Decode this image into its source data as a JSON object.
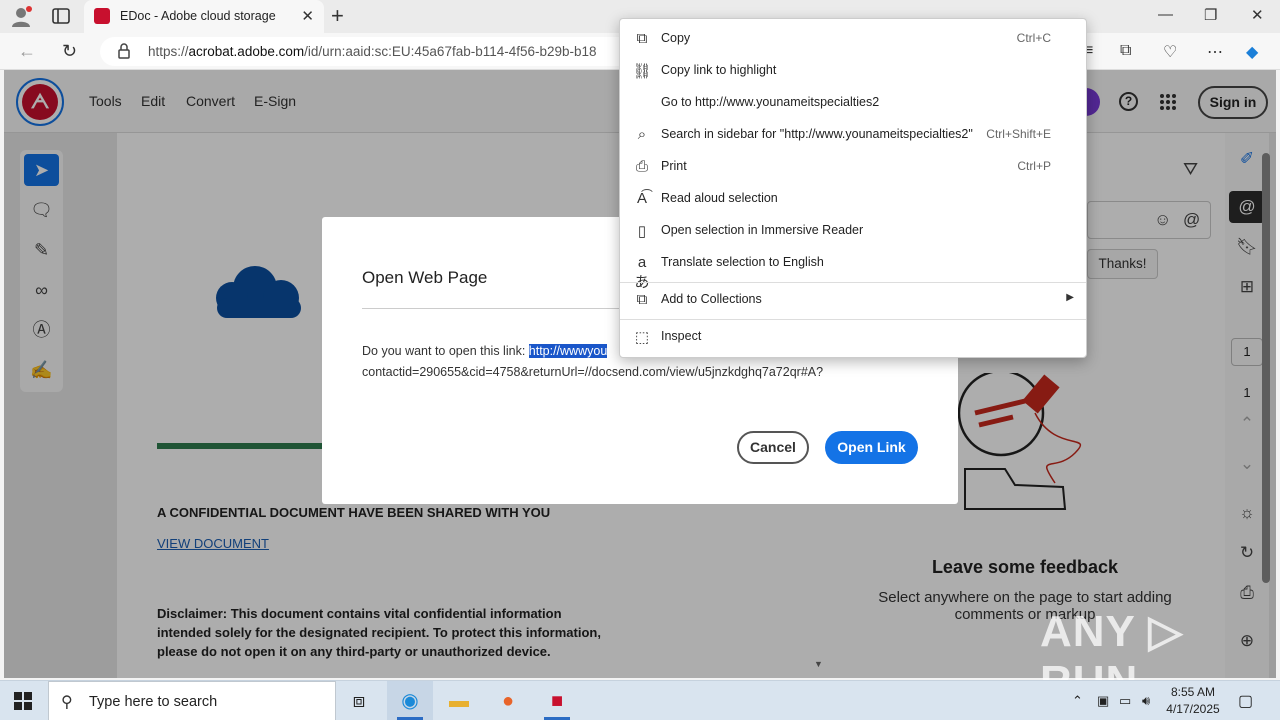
{
  "browser": {
    "tab_title": "EDoc - Adobe cloud storage",
    "tab_close": "✕",
    "new_tab": "+",
    "url_prefix": "https://",
    "url_domain": "acrobat.adobe.com",
    "url_path": "/id/urn:aaid:sc:EU:45a67fab-b114-4f56-b29b-b18",
    "controls": {
      "minimize": "—",
      "maximize": "❐",
      "close": "✕"
    }
  },
  "app": {
    "menu": [
      "Tools",
      "Edit",
      "Convert",
      "E-Sign"
    ],
    "sign_in": "Sign in",
    "help": "?"
  },
  "document": {
    "heading": "A CONFIDENTIAL DOCUMENT HAVE BEEN SHARED WITH YOU",
    "link": "VIEW DOCUMENT",
    "disclaimer": "Disclaimer: This document contains vital confidential information intended solely for the designated recipient. To protect this information, please do not open it on any third-party or unauthorized device."
  },
  "right_panel": {
    "quick_reply": "Thanks!",
    "feedback_title": "Leave some feedback",
    "feedback_sub": "Select anywhere on the page to start adding comments or markup",
    "page_current": "1",
    "page_total": "1"
  },
  "modal": {
    "title": "Open Web Page",
    "prompt": "Do you want to open this link: ",
    "link_selected": "http://wwwyou",
    "link_rest": "contactid=290655&cid=4758&returnUrl=//docsend.com/view/u5jnzkdghq7a72qr#A?",
    "cancel": "Cancel",
    "open": "Open Link"
  },
  "context_menu": {
    "items": [
      {
        "label": "Copy",
        "shortcut": "Ctrl+C",
        "icon": "copy-icon"
      },
      {
        "label": "Copy link to highlight",
        "shortcut": "",
        "icon": "link-highlight-icon"
      },
      {
        "label": "Go to http://www.younameitspecialties2",
        "shortcut": "",
        "icon": ""
      },
      {
        "label": "Search in sidebar for \"http://www.younameitspecialties2\"",
        "shortcut": "Ctrl+Shift+E",
        "icon": "sidebar-search-icon"
      },
      {
        "label": "Print",
        "shortcut": "Ctrl+P",
        "icon": "print-icon"
      },
      {
        "label": "Read aloud selection",
        "shortcut": "",
        "icon": "read-aloud-icon"
      },
      {
        "label": "Open selection in Immersive Reader",
        "shortcut": "",
        "icon": "immersive-reader-icon"
      },
      {
        "label": "Translate selection to English",
        "shortcut": "",
        "icon": "translate-icon"
      },
      {
        "label": "Add to Collections",
        "shortcut": "",
        "icon": "collections-icon"
      },
      {
        "label": "Inspect",
        "shortcut": "",
        "icon": "inspect-icon"
      }
    ]
  },
  "taskbar": {
    "search_placeholder": "Type here to search",
    "time": "8:55 AM",
    "date": "4/17/2025"
  },
  "watermark": "ANY ▷ RUN"
}
